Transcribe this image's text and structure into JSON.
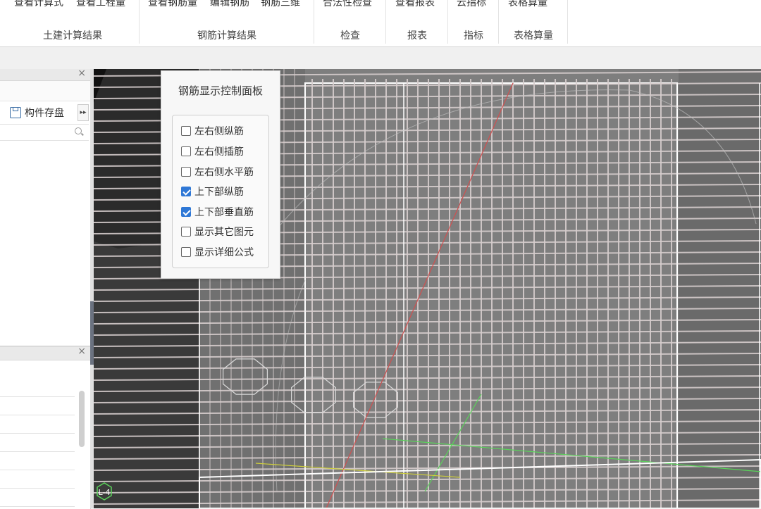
{
  "ribbon": {
    "groups": [
      {
        "title": "土建计算结果",
        "buttons": [
          "查看计算式",
          "查看工程量"
        ]
      },
      {
        "title": "钢筋计算结果",
        "buttons": [
          "查看钢筋量",
          "编辑钢筋",
          "钢筋三维"
        ]
      },
      {
        "title": "检查",
        "buttons": [
          "合法性检查"
        ]
      },
      {
        "title": "报表",
        "buttons": [
          "查看报表"
        ]
      },
      {
        "title": "指标",
        "buttons": [
          "云指标"
        ]
      },
      {
        "title": "表格算量",
        "buttons": [
          "表格算量"
        ]
      }
    ]
  },
  "left_panel": {
    "close_glyph": "×",
    "save_button": "构件存盘",
    "more_glyph": "▸▸",
    "search_icon": "search-icon"
  },
  "left_panel_bottom": {
    "close_glyph": "×"
  },
  "rebar_panel": {
    "title": "钢筋显示控制面板",
    "options": [
      {
        "label": "左右侧纵筋",
        "checked": false
      },
      {
        "label": "左右侧插筋",
        "checked": false
      },
      {
        "label": "左右侧水平筋",
        "checked": false
      },
      {
        "label": "上下部纵筋",
        "checked": true
      },
      {
        "label": "上下部垂直筋",
        "checked": true
      },
      {
        "label": "显示其它图元",
        "checked": false
      },
      {
        "label": "显示详细公式",
        "checked": false
      }
    ]
  },
  "viewport": {
    "axis_label": "L-4",
    "colors": {
      "background": "#2b2b2b",
      "rebar": "#d6cdcd",
      "frame": "#ffffff",
      "axis_green": "#5ad35a",
      "axis_red": "#d05050",
      "axis_yellow": "#cfcf3a"
    }
  }
}
